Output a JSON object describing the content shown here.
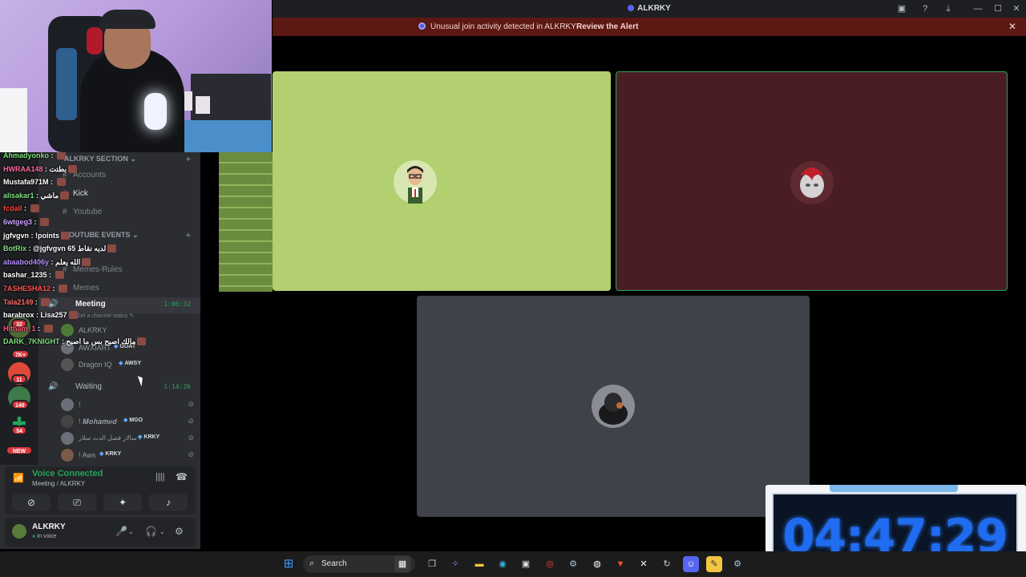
{
  "window": {
    "title": "ALKRKY",
    "controls": [
      "inbox-icon",
      "help-icon",
      "download-icon",
      "minimize-icon",
      "maximize-icon",
      "close-icon"
    ]
  },
  "alert": {
    "message": "Unusual join activity detected in ALKRKY",
    "action_label": "Review the Alert",
    "close_glyph": "✕"
  },
  "sidebar": {
    "categories": [
      {
        "label": "ALKRKY SECTION ⌄",
        "plus": "+"
      },
      {
        "label": "YOUTUBE EVENTS ⌄",
        "plus": "+"
      }
    ],
    "channels": [
      {
        "label": "Accounts"
      },
      {
        "label": "Kick"
      },
      {
        "label": "Youtube"
      },
      {
        "label": "Memes-Rules"
      },
      {
        "label": "Memes"
      }
    ],
    "voice_channels": [
      {
        "label": "Meeting",
        "timer": "1:06:32",
        "status_hint": "Set a channel status ✎"
      },
      {
        "label": "Waiting",
        "timer": "1:14:26"
      }
    ],
    "meeting_users": [
      {
        "name": "ALKRKY",
        "tag": ""
      },
      {
        "name": "AWXIART",
        "tag": "GOAT"
      },
      {
        "name": "Dragon IQ",
        "tag": "AWSY"
      }
    ],
    "waiting_users": [
      {
        "name": "!",
        "tag": ""
      },
      {
        "name": "! 𝑴𝒐𝒉𝒂𝒎𝒆𝒅",
        "tag": "MGO"
      },
      {
        "name": "سالار فصل الدث سلار !",
        "tag": "KRKY"
      },
      {
        "name": "! Aws",
        "tag": "KRKY"
      }
    ],
    "server_badges": [
      "32",
      "7K+",
      "11",
      "149",
      "54",
      "NEW"
    ]
  },
  "chat": [
    {
      "user": "Ahmadyonko",
      "color": "#7fe07f",
      "msg": ""
    },
    {
      "user": "HWRAA148",
      "color": "#ff6b9a",
      "msg": "بطتت"
    },
    {
      "user": "Mustafa971M",
      "color": "#ffffff",
      "msg": ""
    },
    {
      "user": "alisakar1",
      "color": "#7fe07f",
      "msg": "ماشي"
    },
    {
      "user": "fcdall",
      "color": "#ff4444",
      "msg": ""
    },
    {
      "user": "6wtgeg3",
      "color": "#d0a0ff",
      "msg": ""
    },
    {
      "user": "jgfvgvn",
      "color": "#ffffff",
      "msg": "!points"
    },
    {
      "user": "BotRix",
      "color": "#7fe07f",
      "msg": "@jgfvgvn لديه نقاط 65"
    },
    {
      "user": "abaabod406y",
      "color": "#b58cff",
      "msg": "الله يعلم"
    },
    {
      "user": "bashar_1235",
      "color": "#ffffff",
      "msg": ""
    },
    {
      "user": "7ASHESHA12",
      "color": "#ff5555",
      "msg": ""
    },
    {
      "user": "Tala2149",
      "color": "#ff6b6b",
      "msg": ""
    },
    {
      "user": "barabrox",
      "color": "#ffffff",
      "msg": "Lisa257"
    },
    {
      "user": "Hitham_1",
      "color": "#ff5577",
      "msg": ""
    },
    {
      "user": "DARK_7KNIGHT",
      "color": "#7fe07f",
      "msg": "مالك اصبح بس ما اصبح"
    }
  ],
  "voice_panel": {
    "status": "Voice Connected",
    "route": "Meeting / ALKRKY"
  },
  "user_panel": {
    "name": "ALKRKY",
    "status": "In voice"
  },
  "colors": {
    "tile_green": "#b2d06f",
    "tile_maroon": "#4a1d25",
    "tile_gray": "#404249",
    "alert_bg": "#5c1813",
    "discord_green": "#23a55a",
    "clock_digits": "#1f6cf0"
  },
  "overlay_clock": "04:47:29",
  "taskbar": {
    "search_label": "Search",
    "apps": [
      "windows-start-icon",
      "widgets-icon",
      "task-view-icon",
      "copilot-icon",
      "file-explorer-icon",
      "edge-icon",
      "store-icon",
      "chrome-icon",
      "steam-icon",
      "obs-icon",
      "brave-icon",
      "capcut-icon",
      "settings-app-icon",
      "discord-icon",
      "notes-icon",
      "gear-icon"
    ]
  }
}
